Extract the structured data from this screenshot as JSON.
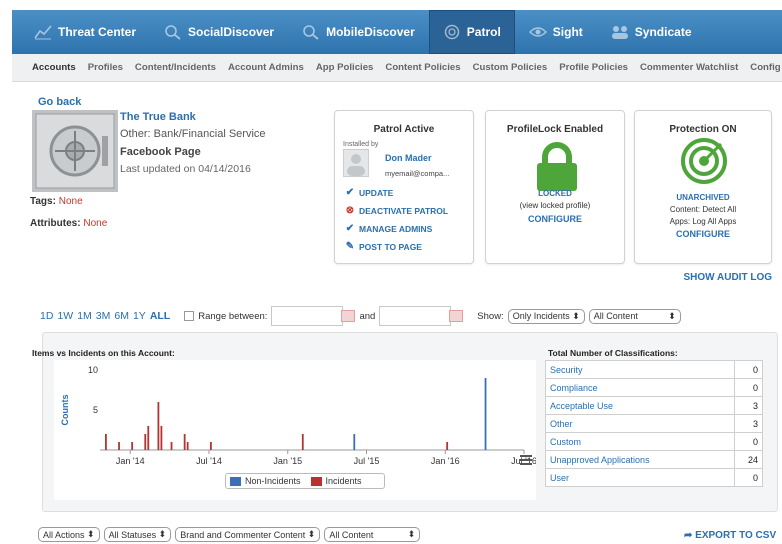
{
  "topnav": [
    {
      "label": "Threat Center",
      "icon": "chart-line-icon",
      "active": false
    },
    {
      "label": "SocialDiscover",
      "icon": "search-icon",
      "active": false
    },
    {
      "label": "MobileDiscover",
      "icon": "search-icon",
      "active": false
    },
    {
      "label": "Patrol",
      "icon": "shield-icon",
      "active": true
    },
    {
      "label": "Sight",
      "icon": "eye-icon",
      "active": false
    },
    {
      "label": "Syndicate",
      "icon": "group-icon",
      "active": false
    }
  ],
  "subnav": [
    "Accounts",
    "Profiles",
    "Content/Incidents",
    "Account Admins",
    "App Policies",
    "Content Policies",
    "Custom Policies",
    "Profile Policies",
    "Commenter Watchlist",
    "Config"
  ],
  "account": {
    "go_back": "Go back",
    "name": "The True Bank",
    "type": "Other: Bank/Financial Service",
    "page_type": "Facebook Page",
    "updated": "Last updated on 04/14/2016",
    "tags_label": "Tags:",
    "tags_value": "None",
    "attributes_label": "Attributes:",
    "attributes_value": "None"
  },
  "patrol_card": {
    "title": "Patrol Active",
    "installed_by": "Installed by",
    "installer": "Don Mader",
    "email": "myemail@compa...",
    "actions": [
      {
        "label": "UPDATE",
        "icon": "check-icon"
      },
      {
        "label": "DEACTIVATE PATROL",
        "icon": "stop-icon"
      },
      {
        "label": "MANAGE ADMINS",
        "icon": "check-icon"
      },
      {
        "label": "POST TO PAGE",
        "icon": "pencil-icon"
      }
    ]
  },
  "profilelock_card": {
    "title": "ProfileLock Enabled",
    "status": "LOCKED",
    "view_link": "(view locked profile)",
    "configure": "CONFIGURE"
  },
  "protection_card": {
    "title": "Protection ON",
    "status": "UNARCHIVED",
    "line1": "Content: Detect All",
    "line2": "Apps: Log All Apps",
    "configure": "CONFIGURE"
  },
  "audit_log": "SHOW AUDIT LOG",
  "filters": {
    "ranges": [
      "1D",
      "1W",
      "1M",
      "3M",
      "6M",
      "1Y",
      "ALL"
    ],
    "selected_range": "ALL",
    "range_between": "Range between:",
    "and": "and",
    "show": "Show:",
    "show_select": "Only Incidents",
    "content_select": "All Content"
  },
  "chart_title": "Items vs Incidents on this Account:",
  "chart_data": {
    "type": "bar",
    "title": "Items vs Incidents on this Account:",
    "ylabel": "Counts",
    "xlabel": "",
    "ylim": [
      0,
      10
    ],
    "yticks": [
      5,
      10
    ],
    "xticks": [
      "Jan '14",
      "Jul '14",
      "Jan '15",
      "Jul '15",
      "Jan '16",
      "Jul '16"
    ],
    "grid": false,
    "legend": "bottom-center",
    "x_start": "2013-11",
    "x_end": "2016-07",
    "series": [
      {
        "name": "Non-Incidents",
        "color": "#3b6fb6",
        "points": [
          [
            "2015-06",
            2
          ],
          [
            "2016-04",
            9
          ]
        ]
      },
      {
        "name": "Incidents",
        "color": "#b83232",
        "points": [
          [
            "2013-11",
            2
          ],
          [
            "2013-12",
            1
          ],
          [
            "2014-01",
            1
          ],
          [
            "2014-02",
            2
          ],
          [
            "2014-02",
            3
          ],
          [
            "2014-03",
            6
          ],
          [
            "2014-03",
            3
          ],
          [
            "2014-04",
            1
          ],
          [
            "2014-05",
            2
          ],
          [
            "2014-05",
            1
          ],
          [
            "2014-07",
            1
          ],
          [
            "2015-02",
            2
          ],
          [
            "2016-01",
            1
          ]
        ]
      }
    ]
  },
  "classifications_title": "Total Number of Classifications:",
  "classifications": [
    {
      "name": "Security",
      "value": "0"
    },
    {
      "name": "Compliance",
      "value": "0"
    },
    {
      "name": "Acceptable Use",
      "value": "3"
    },
    {
      "name": "Other",
      "value": "3"
    },
    {
      "name": "Custom",
      "value": "0"
    },
    {
      "name": "Unapproved Applications",
      "value": "24"
    },
    {
      "name": "User",
      "value": "0"
    }
  ],
  "bottom_filters": [
    "All Actions",
    "All Statuses",
    "Brand and Commenter Content",
    "All Content"
  ],
  "export": "EXPORT TO CSV",
  "colors": {
    "nav": "#3a80bd",
    "link": "#2a6fb0",
    "green": "#4ea63a",
    "incident": "#b83232",
    "non_incident": "#3b6fb6"
  }
}
